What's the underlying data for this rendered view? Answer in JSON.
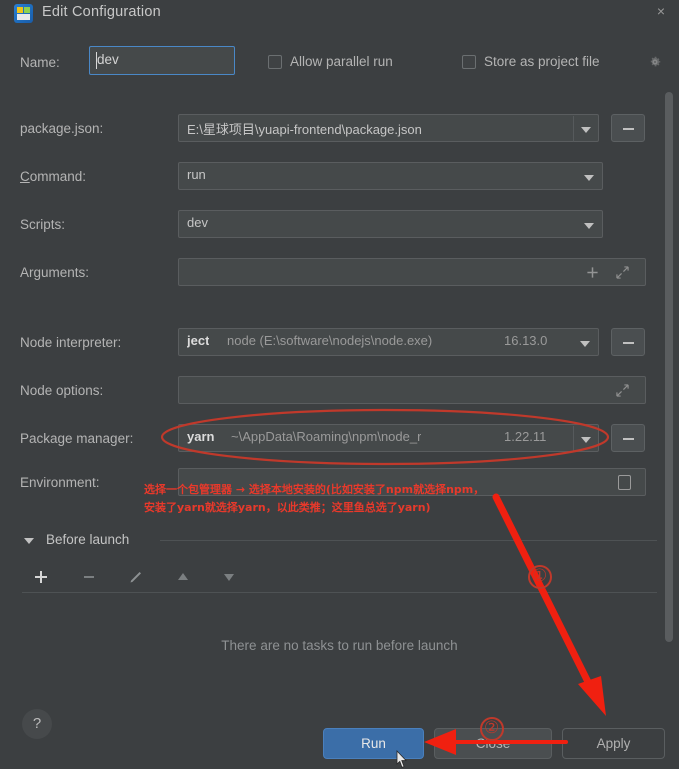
{
  "window": {
    "title": "Edit Configuration",
    "icon": "npm-run-config-icon",
    "close_label": "×"
  },
  "name_row": {
    "label": "Name:",
    "value": "dev",
    "checkbox_allow_parallel": "Allow parallel run",
    "checkbox_store_project": "Store as project file",
    "gear_icon": "gear-icon"
  },
  "fields": [
    {
      "label": "package.json:",
      "value": "E:\\星球项目\\yuapi-frontend\\package.json",
      "has_dropdown": true,
      "has_browse": true
    },
    {
      "label": "Command:",
      "value": "run",
      "has_dropdown": true,
      "has_browse": false
    },
    {
      "label": "Scripts:",
      "value": "dev",
      "has_dropdown": true,
      "has_browse": false
    },
    {
      "label": "Arguments:",
      "value": "",
      "has_dropdown": false,
      "has_browse": false
    },
    {
      "label": "Node interpreter:",
      "value_prefix": "ject",
      "value_main": "node (E:\\software\\nodejs\\node.exe)",
      "value_suffix": "16.13.0",
      "has_dropdown": true,
      "has_browse": true
    },
    {
      "label": "Node options:",
      "value": "",
      "has_dropdown": false,
      "has_browse": false
    },
    {
      "label": "Package manager:",
      "value_prefix": "yarn",
      "value_main": "~\\AppData\\Roaming\\npm\\node_r",
      "value_suffix": "1.22.11",
      "has_dropdown": true,
      "has_browse": true
    },
    {
      "label": "Environment:",
      "value": "",
      "has_dropdown": false,
      "has_browse": false
    }
  ],
  "before_launch": {
    "title": "Before launch",
    "empty_text": "There are no tasks to run before launch",
    "toolbar": [
      "add-icon",
      "remove-icon",
      "edit-icon",
      "move-up-icon",
      "move-down-icon"
    ]
  },
  "bottom": {
    "help_label": "?",
    "run_label": "Run",
    "close_label": "Close",
    "apply_label": "Apply"
  },
  "annotations": {
    "line1": "选择一个包管理器 → 选择本地安装的(比如安装了npm就选择npm，",
    "line2": "安装了yarn就选择yarn，以此类推；这里鱼总选了yarn)",
    "marker1": "①",
    "marker2": "②",
    "highlight_color": "#e8392b"
  }
}
